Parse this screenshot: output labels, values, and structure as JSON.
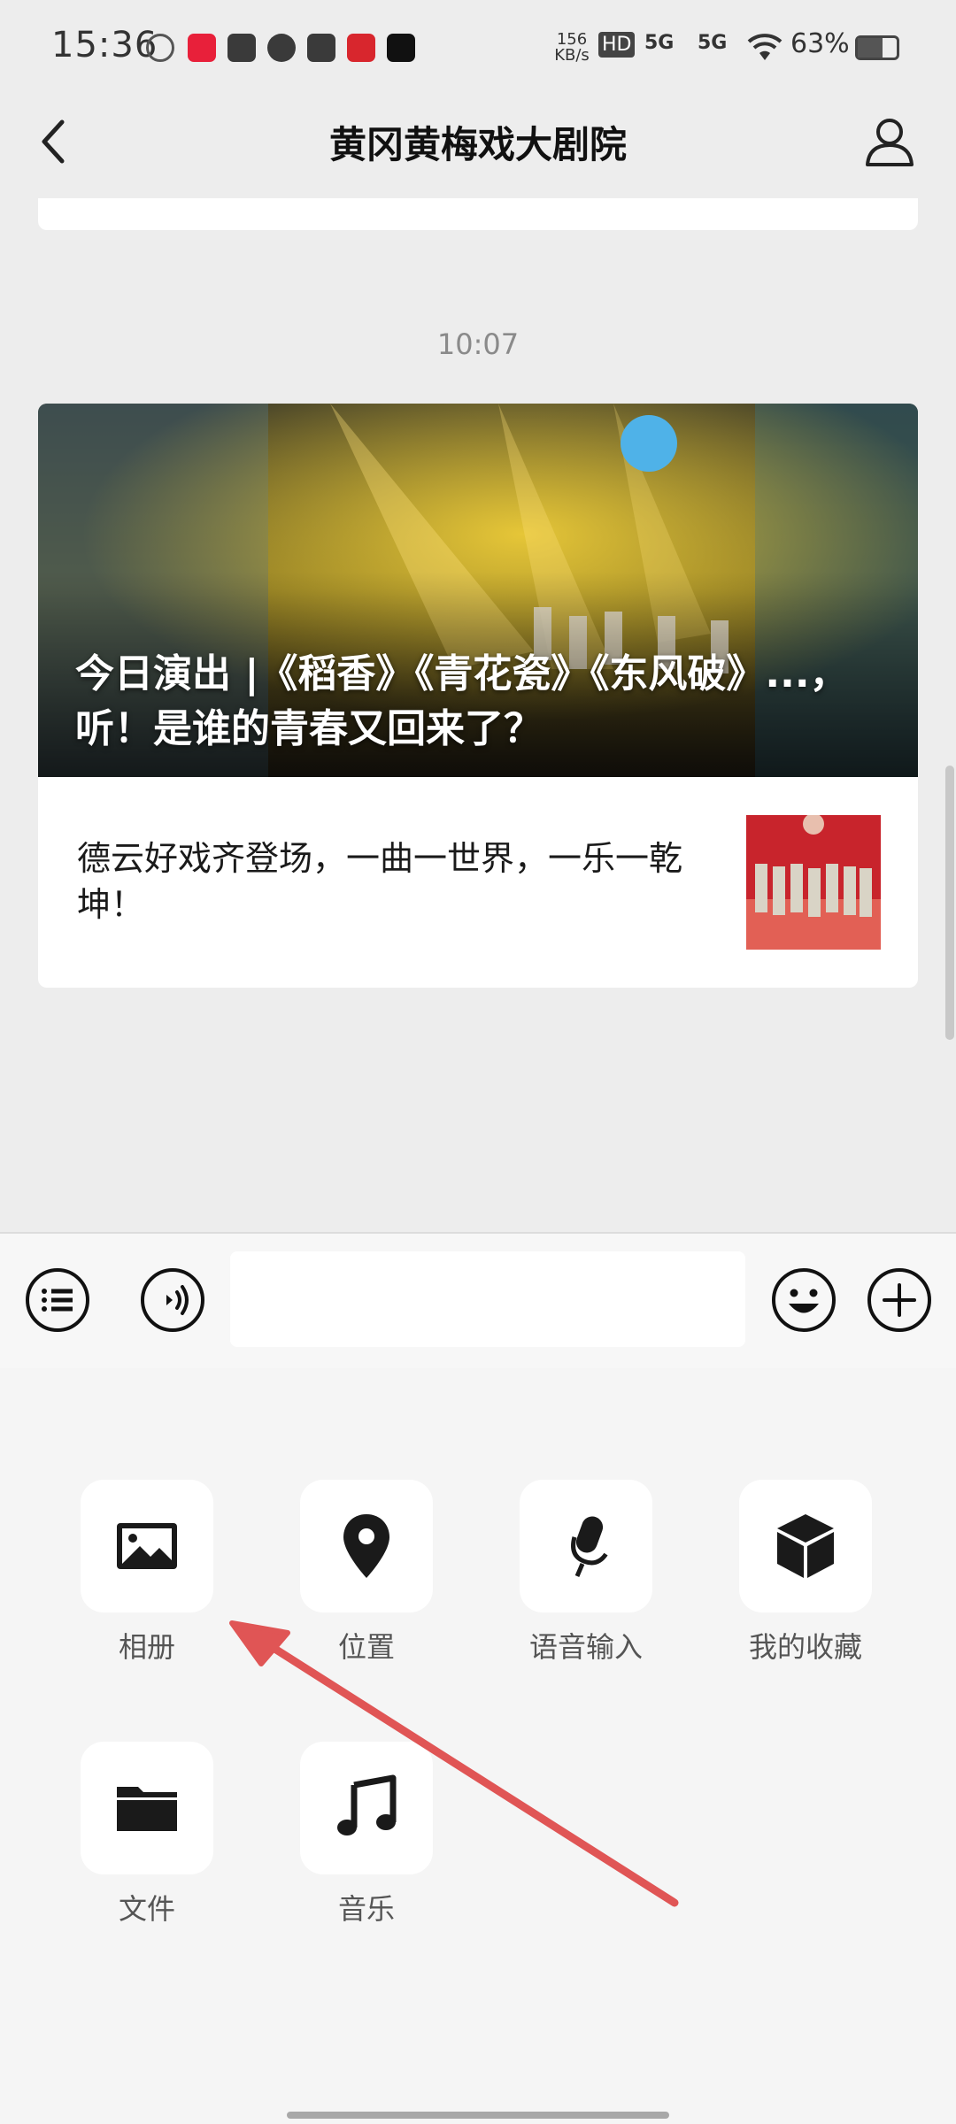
{
  "status_bar": {
    "time": "15:36",
    "app_icons": [
      {
        "name": "app-icon-red",
        "color": "#e8203a"
      },
      {
        "name": "taobao-icon",
        "color": "#3a3a3a"
      },
      {
        "name": "fan-icon",
        "color": "#3a3a3a"
      },
      {
        "name": "vivo-icon",
        "color": "#3a3a3a"
      },
      {
        "name": "store-icon",
        "color": "#d8262d"
      },
      {
        "name": "capcut-icon",
        "color": "#111111"
      }
    ],
    "net_speed": "156 KB/s",
    "hd": "HD",
    "signal_1": "5G",
    "signal_2": "5G",
    "battery": "63%"
  },
  "header": {
    "title": "黄冈黄梅戏大剧院"
  },
  "chat": {
    "timestamp": "10:07",
    "article": {
      "headline": "今日演出 |《稻香》《青花瓷》《东风破》...，听！是谁的青春又回来了？",
      "sub_item": "德云好戏齐登场，一曲一世界，一乐一乾坤！"
    }
  },
  "input_bar": {
    "placeholder": ""
  },
  "panel": {
    "items": [
      {
        "label": "相册",
        "icon": "image-icon"
      },
      {
        "label": "位置",
        "icon": "location-pin-icon"
      },
      {
        "label": "语音输入",
        "icon": "microphone-icon"
      },
      {
        "label": "我的收藏",
        "icon": "cube-icon"
      },
      {
        "label": "文件",
        "icon": "folder-icon"
      },
      {
        "label": "音乐",
        "icon": "music-note-icon"
      }
    ]
  },
  "colors": {
    "background": "#ededed",
    "panel": "#f5f5f5",
    "annotation_arrow": "#e05555"
  }
}
